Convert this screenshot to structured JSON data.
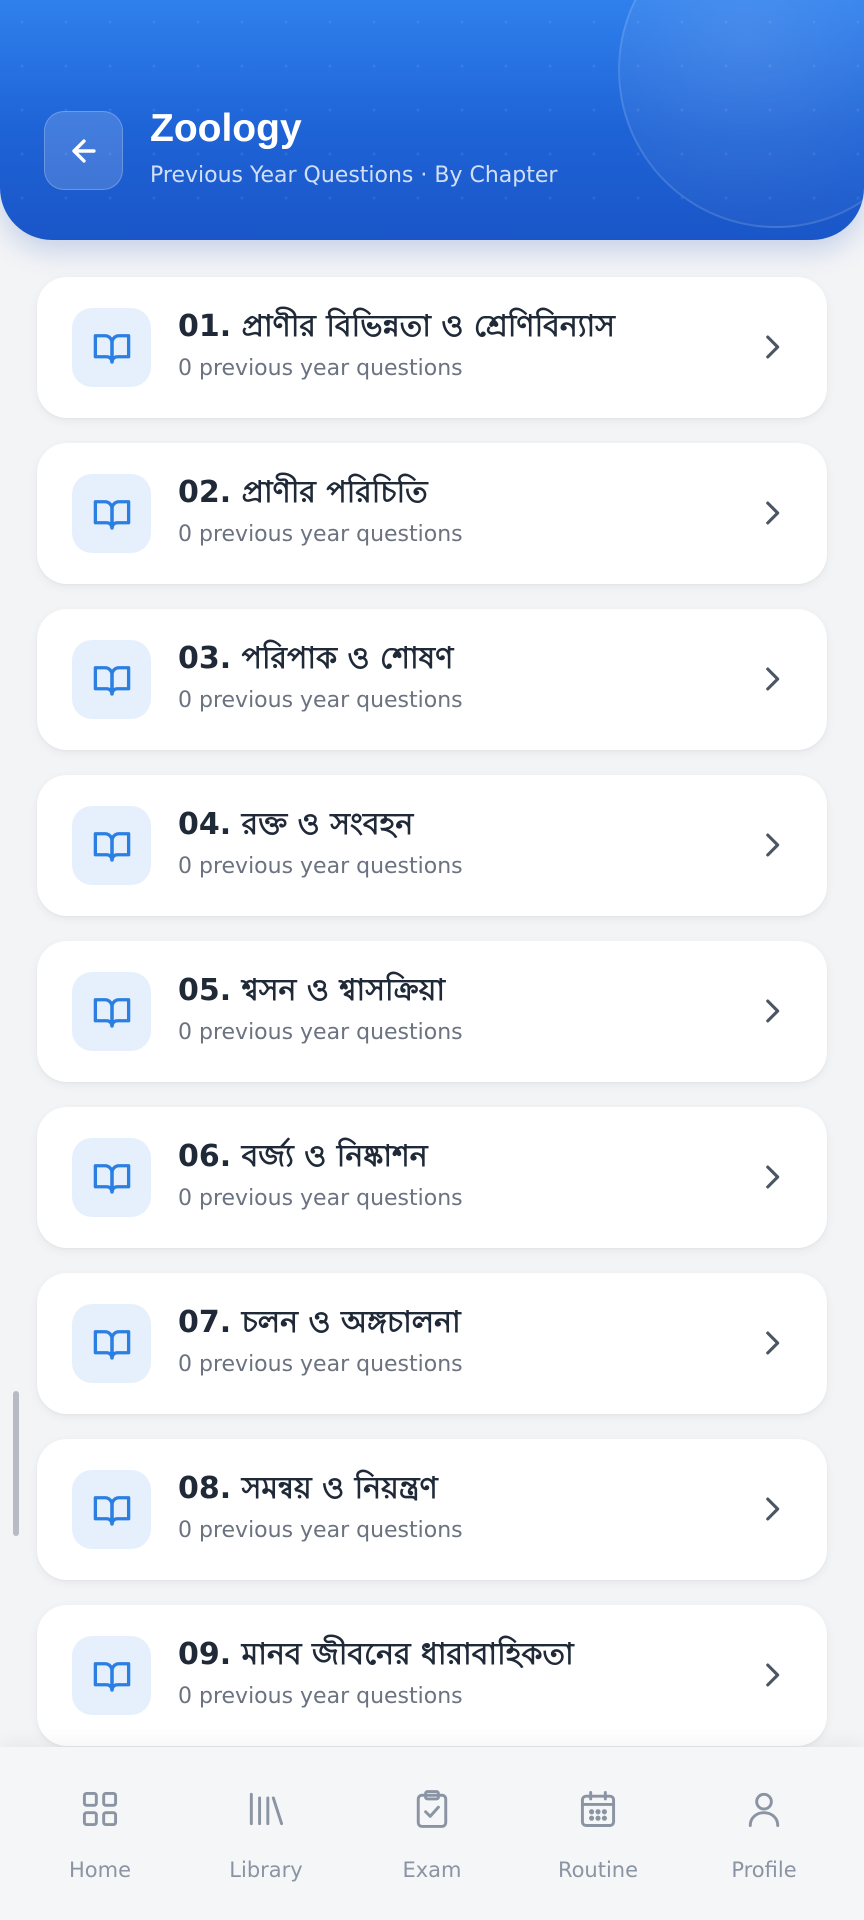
{
  "header": {
    "title": "Zoology",
    "subtitle": "Previous Year Questions · By Chapter"
  },
  "chapters": [
    {
      "title": "01. প্রাণীর বিভিন্নতা ও শ্রেণিবিন্যাস",
      "subtitle": "0 previous year questions"
    },
    {
      "title": "02. প্রাণীর পরিচিতি",
      "subtitle": "0 previous year questions"
    },
    {
      "title": "03. পরিপাক ও শোষণ",
      "subtitle": "0 previous year questions"
    },
    {
      "title": "04. রক্ত ও সংবহন",
      "subtitle": "0 previous year questions"
    },
    {
      "title": "05. শ্বসন ও শ্বাসক্রিয়া",
      "subtitle": "0 previous year questions"
    },
    {
      "title": "06. বর্জ্য ও নিষ্কাশন",
      "subtitle": "0 previous year questions"
    },
    {
      "title": "07. চলন ও অঙ্গচালনা",
      "subtitle": "0 previous year questions"
    },
    {
      "title": "08. সমন্বয় ও নিয়ন্ত্রণ",
      "subtitle": "0 previous year questions"
    },
    {
      "title": "09. মানব জীবনের ধারাবাহিকতা",
      "subtitle": "0 previous year questions"
    }
  ],
  "icons": {
    "back": "arrow-left-icon",
    "chapter": "book-open-icon",
    "row_action": "chevron-right-icon"
  },
  "nav": [
    {
      "label": "Home",
      "icon": "grid-icon"
    },
    {
      "label": "Library",
      "icon": "library-icon"
    },
    {
      "label": "Exam",
      "icon": "clipboard-check-icon"
    },
    {
      "label": "Routine",
      "icon": "calendar-icon"
    },
    {
      "label": "Profile",
      "icon": "user-icon"
    }
  ],
  "colors": {
    "primary": "#1e63d6",
    "icon_bg": "#e6f0fc",
    "icon_fg": "#2b7fe3",
    "text_primary": "#1f2937",
    "text_secondary": "#6b7280",
    "nav_inactive": "#8a94a3"
  }
}
